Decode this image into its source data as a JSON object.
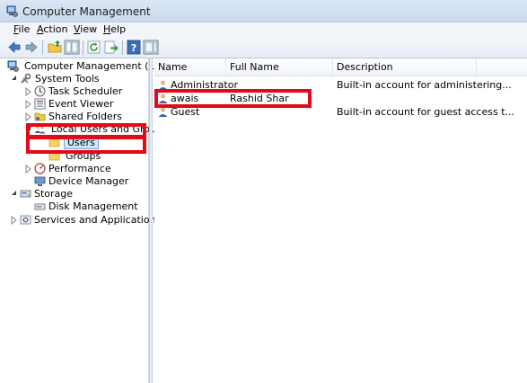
{
  "window": {
    "title": "Computer Management"
  },
  "menu": [
    {
      "label": "File",
      "accel": "F",
      "rest": "ile"
    },
    {
      "label": "Action",
      "accel": "A",
      "rest": "ction"
    },
    {
      "label": "View",
      "accel": "V",
      "rest": "iew"
    },
    {
      "label": "Help",
      "accel": "H",
      "rest": "elp"
    }
  ],
  "toolbar": {
    "icons": [
      "back-icon",
      "forward-icon",
      "up-folder-icon",
      "show-hide-tree-icon",
      "refresh-icon",
      "export-icon",
      "help-icon",
      "action-pane-icon"
    ]
  },
  "tree": {
    "root": "Computer Management (Local)",
    "system_tools": "System Tools",
    "task_scheduler": "Task Scheduler",
    "event_viewer": "Event Viewer",
    "shared_folders": "Shared Folders",
    "local_users_groups": "Local Users and Groups",
    "users": "Users",
    "groups": "Groups",
    "performance": "Performance",
    "device_manager": "Device Manager",
    "storage": "Storage",
    "disk_management": "Disk Management",
    "services_apps": "Services and Applications"
  },
  "list": {
    "columns": [
      "Name",
      "Full Name",
      "Description"
    ],
    "rows": [
      {
        "name": "Administrator",
        "full_name": "",
        "description": "Built-in account for administering..."
      },
      {
        "name": "awais",
        "full_name": "Rashid Shar",
        "description": ""
      },
      {
        "name": "Guest",
        "full_name": "",
        "description": "Built-in account for guest access t..."
      }
    ]
  },
  "colors": {
    "highlight": "#e20a16",
    "selection": "#cce8ff",
    "titlebar": "#dbe7f5"
  }
}
